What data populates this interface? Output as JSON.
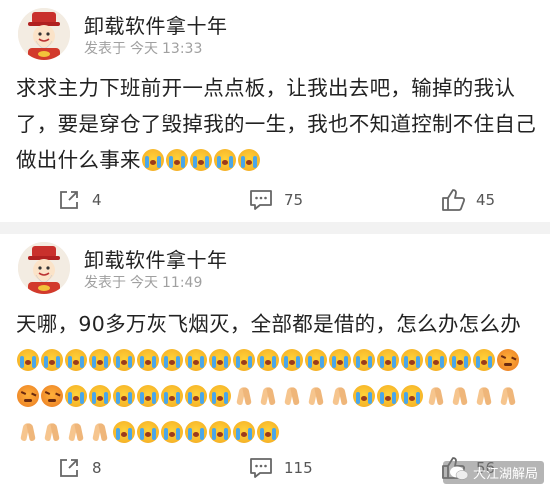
{
  "posts": [
    {
      "user": "卸载软件拿十年",
      "time": {
        "prefix": "发表于",
        "date": "今天",
        "clock": "13:33"
      },
      "text": "求求主力下班前开一点点板，让我出去吧，输掉的我认了，要是穿仓了毁掉我的一生，我也不知道控制不住自己做出什么事来",
      "emojis": [
        "loudly-crying",
        "loudly-crying",
        "loudly-crying",
        "loudly-crying",
        "loudly-crying"
      ],
      "actions": {
        "share": "4",
        "comment": "75",
        "like": "45"
      }
    },
    {
      "user": "卸载软件拿十年",
      "time": {
        "prefix": "发表于",
        "date": "今天",
        "clock": "11:49"
      },
      "text": "天哪，90多万灰飞烟灭，全部都是借的，怎么办怎么办",
      "emojis": [
        "loudly-crying",
        "loudly-crying",
        "loudly-crying",
        "loudly-crying",
        "loudly-crying",
        "loudly-crying",
        "loudly-crying",
        "loudly-crying",
        "loudly-crying",
        "loudly-crying",
        "loudly-crying",
        "loudly-crying",
        "loudly-crying",
        "loudly-crying",
        "loudly-crying",
        "loudly-crying",
        "loudly-crying",
        "loudly-crying",
        "loudly-crying",
        "loudly-crying",
        "angry",
        "angry",
        "angry",
        "loudly-crying",
        "loudly-crying",
        "loudly-crying",
        "loudly-crying",
        "loudly-crying",
        "loudly-crying",
        "loudly-crying",
        "folded-hands",
        "folded-hands",
        "folded-hands",
        "folded-hands",
        "folded-hands",
        "loudly-crying",
        "loudly-crying",
        "loudly-crying",
        "folded-hands",
        "folded-hands",
        "folded-hands",
        "folded-hands",
        "folded-hands",
        "folded-hands",
        "folded-hands",
        "folded-hands",
        "loudly-crying",
        "loudly-crying",
        "loudly-crying",
        "loudly-crying",
        "loudly-crying",
        "loudly-crying",
        "loudly-crying"
      ],
      "actions": {
        "share": "8",
        "comment": "115",
        "like": "56"
      }
    }
  ],
  "watermark": "大江湖解局",
  "colors": {
    "name": "#222222",
    "meta": "#a0a0a0",
    "separator": "#f2f2f2",
    "icon": "#555555"
  }
}
